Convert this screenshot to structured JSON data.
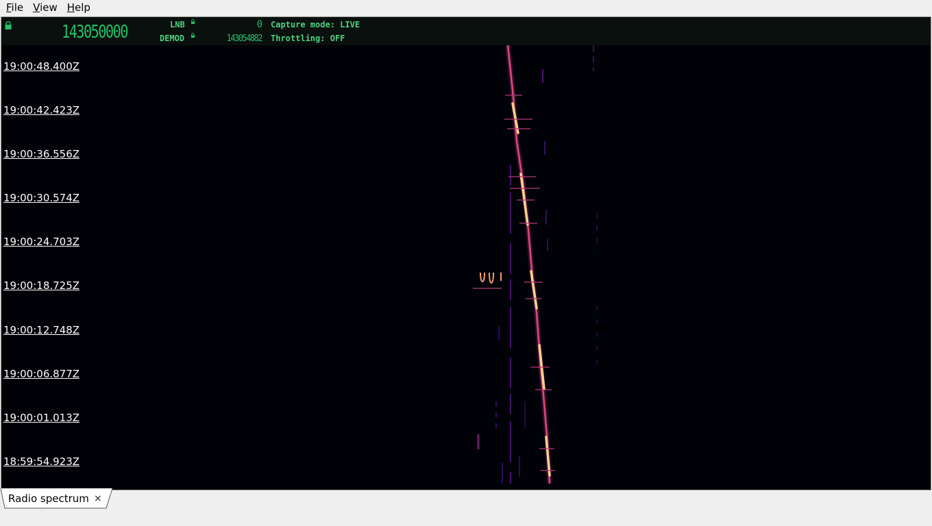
{
  "menu": {
    "items": [
      {
        "label": "File",
        "mnemonic": "F",
        "rest": "ile"
      },
      {
        "label": "View",
        "mnemonic": "V",
        "rest": "iew"
      },
      {
        "label": "Help",
        "mnemonic": "H",
        "rest": "elp"
      }
    ]
  },
  "header": {
    "frequency": "143050000",
    "lnb_label": "LNB",
    "lnb_value": "0",
    "demod_label": "DEMOD",
    "demod_value": "143054882",
    "capture_mode": "Capture mode: LIVE",
    "throttling": "Throttling: OFF",
    "accent_color": "#1fc16a"
  },
  "waterfall": {
    "timestamps": [
      "19:00:48.400Z",
      "19:00:42.423Z",
      "19:00:36.556Z",
      "19:00:30.574Z",
      "19:00:24.703Z",
      "19:00:18.725Z",
      "19:00:12.748Z",
      "19:00:06.877Z",
      "19:00:01.013Z",
      "18:59:54.923Z"
    ],
    "colormap": [
      "#000000",
      "#3b0f70",
      "#8c2981",
      "#de4968",
      "#fe9f6d",
      "#fcfdbf"
    ]
  },
  "tabs": [
    {
      "label": "Radio spectrum",
      "close_glyph": "×"
    }
  ]
}
